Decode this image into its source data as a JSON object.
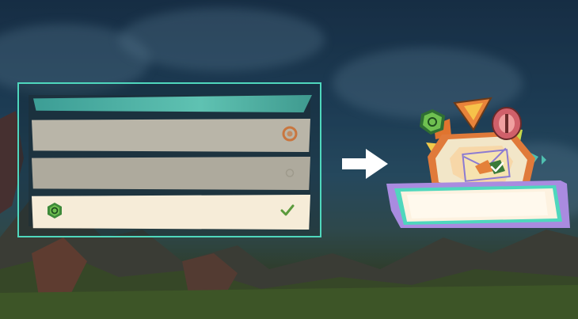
{
  "scene": {
    "description_visible_text": ""
  },
  "quest_panel": {
    "rows": [
      {
        "state": "pending",
        "icon": "orange-ring-icon"
      },
      {
        "state": "faded",
        "icon": "faded-circle-icon"
      },
      {
        "state": "completed",
        "icon": "green-spiral-emblem-icon",
        "status_icon": "checkmark-icon"
      }
    ]
  },
  "arrow": {
    "icon": "right-arrow-icon"
  },
  "badge": {
    "icons": [
      "green-spiral-emblem-icon",
      "orange-triangle-emblem-icon",
      "red-mask-emblem-icon",
      "envelope-icon",
      "checkmark-icon"
    ]
  },
  "colors": {
    "panel_outline": "#4fd7bd",
    "header_teal": "#5fc2b2",
    "row_active": "#f6ecd8",
    "row_inactive": "#b9b5a8",
    "check_green": "#5b9a3c",
    "accent_orange": "#e0742f",
    "accent_purple": "#a98be0"
  }
}
